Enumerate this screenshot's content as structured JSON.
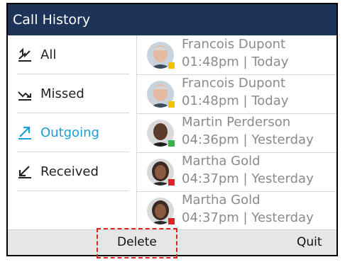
{
  "title": "Call History",
  "filters": [
    {
      "label": "All",
      "icon": "all-calls-icon"
    },
    {
      "label": "Missed",
      "icon": "missed-call-icon"
    },
    {
      "label": "Outgoing",
      "icon": "outgoing-call-icon"
    },
    {
      "label": "Received",
      "icon": "received-call-icon"
    }
  ],
  "selected_filter": "Outgoing",
  "calls": [
    {
      "name": "Francois Dupont",
      "time": "01:48pm | Today",
      "status_color": "#f2c400"
    },
    {
      "name": "Francois Dupont",
      "time": "01:48pm | Today",
      "status_color": "#f2c400"
    },
    {
      "name": "Martin Perderson",
      "time": "04:36pm | Yesterday",
      "status_color": "#2fb64a"
    },
    {
      "name": "Martha Gold",
      "time": "04:37pm | Yesterday",
      "status_color": "#e0202a"
    },
    {
      "name": "Martha Gold",
      "time": "04:37pm | Yesterday",
      "status_color": "#e0202a"
    }
  ],
  "softkeys": {
    "delete": "Delete",
    "quit": "Quit"
  },
  "colors": {
    "titlebar": "#1d3357",
    "accent": "#1a9fd9",
    "highlight": "#e02020"
  }
}
